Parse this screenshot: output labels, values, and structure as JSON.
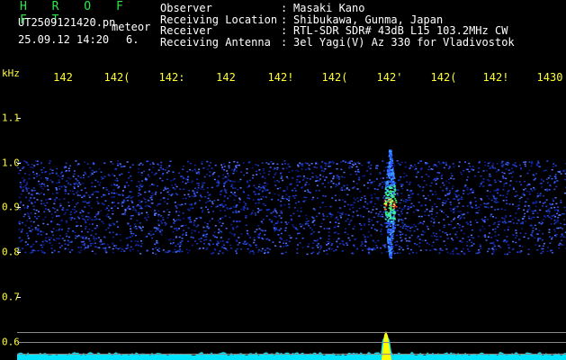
{
  "header": {
    "brand": "H R O F F T",
    "filename": "UT2509121420.pn",
    "tag": "meteor",
    "datetime": "25.09.12 14:20",
    "count": "6."
  },
  "info": [
    {
      "label": "Observer",
      "sep": ":",
      "value": "Masaki Kano"
    },
    {
      "label": "Receiving Location",
      "sep": ":",
      "value": "Shibukawa, Gunma, Japan"
    },
    {
      "label": "Receiver",
      "sep": ":",
      "value": "RTL-SDR SDR# 43dB L15 103.2MHz CW"
    },
    {
      "label": "Receiving Antenna",
      "sep": ":",
      "value": "3el Yagi(V) Az 330 for Vladivostok"
    }
  ],
  "axes": {
    "y_unit": "kHz",
    "x_ticks": [
      "142",
      "142(",
      "142:",
      "142",
      "142!",
      "142(",
      "142'",
      "142(",
      "142!",
      "1430"
    ],
    "y_ticks": [
      "1.1",
      "1.0",
      "0.9",
      "0.8",
      "0.7",
      "0.6"
    ]
  },
  "colors": {
    "background": "#000000",
    "axis_text": "#ffff33",
    "brand": "#2ee84a",
    "noise_band": "#1a2fb0",
    "spectrum": "#00e5ff",
    "peak": "#ffff00"
  }
}
